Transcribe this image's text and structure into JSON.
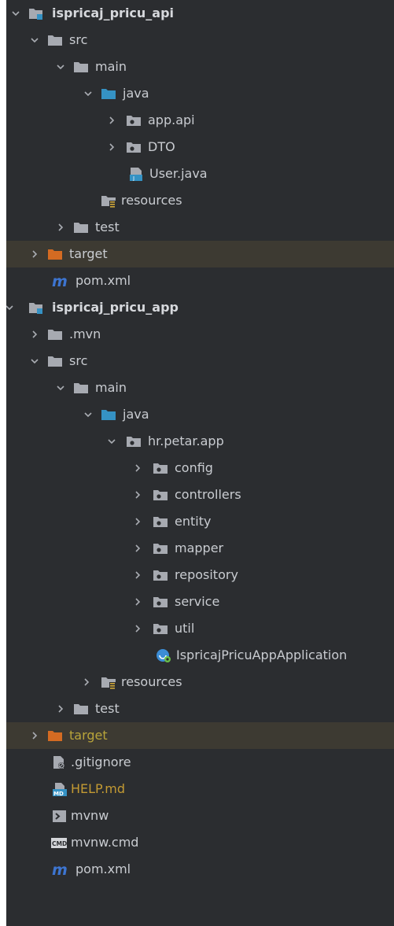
{
  "tree": {
    "items": [
      {
        "label": "ispricaj_pricu_api",
        "icon": "module-folder-icon",
        "expanded": true,
        "bold": true
      },
      {
        "label": "src",
        "icon": "folder-icon",
        "expanded": true
      },
      {
        "label": "main",
        "icon": "folder-icon",
        "expanded": true
      },
      {
        "label": "java",
        "icon": "source-root-folder-icon",
        "expanded": true
      },
      {
        "label": "app.api",
        "icon": "package-icon",
        "expanded": false
      },
      {
        "label": "DTO",
        "icon": "package-icon",
        "expanded": false
      },
      {
        "label": "User.java",
        "icon": "java-file-icon"
      },
      {
        "label": "resources",
        "icon": "resources-folder-icon"
      },
      {
        "label": "test",
        "icon": "folder-icon",
        "expanded": false
      },
      {
        "label": "target",
        "icon": "excluded-folder-icon",
        "expanded": false,
        "selected": true
      },
      {
        "label": "pom.xml",
        "icon": "maven-icon"
      },
      {
        "label": "ispricaj_pricu_app",
        "icon": "module-folder-icon",
        "expanded": true,
        "bold": true
      },
      {
        "label": ".mvn",
        "icon": "folder-icon",
        "expanded": false
      },
      {
        "label": "src",
        "icon": "folder-icon",
        "expanded": true
      },
      {
        "label": "main",
        "icon": "folder-icon",
        "expanded": true
      },
      {
        "label": "java",
        "icon": "source-root-folder-icon",
        "expanded": true
      },
      {
        "label": "hr.petar.app",
        "icon": "package-icon",
        "expanded": true
      },
      {
        "label": "config",
        "icon": "package-icon",
        "expanded": false
      },
      {
        "label": "controllers",
        "icon": "package-icon",
        "expanded": false
      },
      {
        "label": "entity",
        "icon": "package-icon",
        "expanded": false
      },
      {
        "label": "mapper",
        "icon": "package-icon",
        "expanded": false
      },
      {
        "label": "repository",
        "icon": "package-icon",
        "expanded": false
      },
      {
        "label": "service",
        "icon": "package-icon",
        "expanded": false
      },
      {
        "label": "util",
        "icon": "package-icon",
        "expanded": false
      },
      {
        "label": "IspricajPricuAppApplication",
        "icon": "spring-boot-class-icon"
      },
      {
        "label": "resources",
        "icon": "resources-folder-icon",
        "expanded": false
      },
      {
        "label": "test",
        "icon": "folder-icon",
        "expanded": false
      },
      {
        "label": "target",
        "icon": "excluded-folder-icon",
        "expanded": false,
        "selected": true,
        "label_color": "#b8a43a"
      },
      {
        "label": ".gitignore",
        "icon": "gitignore-file-icon"
      },
      {
        "label": "HELP.md",
        "icon": "markdown-file-icon",
        "label_color": "#c39a33"
      },
      {
        "label": "mvnw",
        "icon": "shell-script-icon"
      },
      {
        "label": "mvnw.cmd",
        "icon": "cmd-file-icon"
      },
      {
        "label": "pom.xml",
        "icon": "maven-icon"
      }
    ]
  },
  "colors": {
    "background": "#2b2d30",
    "selection": "#3d3a32",
    "text": "#c9ccd1",
    "folder": "#a7aab1",
    "source_root": "#3592c4",
    "excluded": "#d46b22",
    "maven": "#3d75d1"
  }
}
